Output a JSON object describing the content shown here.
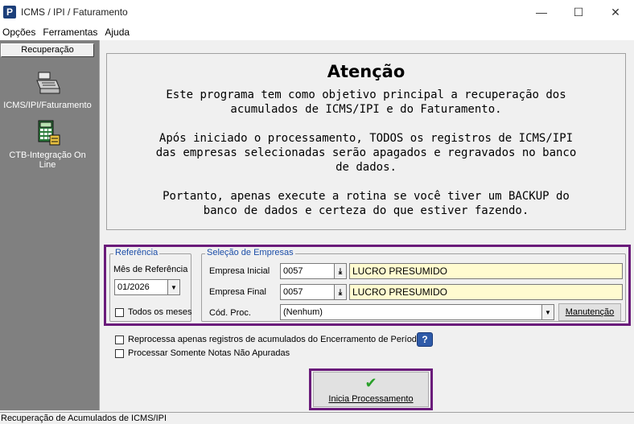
{
  "window": {
    "title": "ICMS / IPI / Faturamento",
    "minimize_glyph": "—",
    "maximize_glyph": "☐",
    "close_glyph": "✕"
  },
  "menu": [
    "Opções",
    "Ferramentas",
    "Ajuda"
  ],
  "sidebar": {
    "header": "Recuperação",
    "items": [
      {
        "label": "ICMS/IPI/Faturamento",
        "icon": "cash-register-icon"
      },
      {
        "label": "CTB-Integração On Line",
        "icon": "calculator-icon"
      }
    ]
  },
  "attention": {
    "title": "Atenção",
    "paragraphs": [
      "Este programa tem como objetivo principal a recuperação dos\nacumulados de ICMS/IPI e do Faturamento.",
      "Após iniciado o processamento, TODOS os registros de ICMS/IPI\ndas empresas selecionadas serão apagados e regravados no banco\nde dados.",
      "Portanto, apenas execute a rotina se você tiver um BACKUP do\nbanco de dados e certeza do que estiver fazendo."
    ]
  },
  "referencia": {
    "group_label": "Referência",
    "mes_label": "Mês de Referência",
    "mes_value": "01/2026",
    "todos_label": "Todos os meses"
  },
  "empresas": {
    "group_label": "Seleção de Empresas",
    "inicial_label": "Empresa Inicial",
    "inicial_code": "0057",
    "inicial_name": "LUCRO PRESUMIDO",
    "final_label": "Empresa Final",
    "final_code": "0057",
    "final_name": "LUCRO PRESUMIDO",
    "cod_label": "Cód. Proc.",
    "cod_value": "(Nenhum)",
    "manutencao": "Manutenção"
  },
  "options": {
    "reprocessa": "Reprocessa apenas registros de acumulados do Encerramento de Período",
    "somente_notas": "Processar Somente Notas Não Apuradas",
    "help_glyph": "?"
  },
  "action": {
    "inicia": "Inicia Processamento",
    "check_glyph": "✔"
  },
  "status": "Recuperação de Acumulados de ICMS/IPI",
  "colors": {
    "highlight": "#6a1b7a",
    "field_yellow": "#fffbd0",
    "sidebar": "#808080",
    "check": "#2aa02a"
  }
}
